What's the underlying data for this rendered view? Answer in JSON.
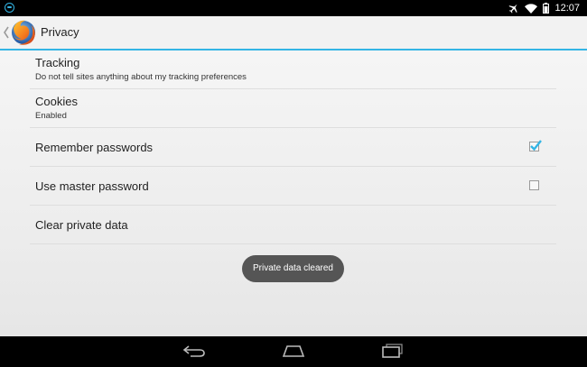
{
  "status_bar": {
    "time": "12:07",
    "icons": [
      "notification-icon",
      "airplane-icon",
      "wifi-icon",
      "battery-icon"
    ]
  },
  "action_bar": {
    "title": "Privacy",
    "logo": "firefox-logo",
    "accent_color": "#33b5e5"
  },
  "settings": [
    {
      "title": "Tracking",
      "summary": "Do not tell sites anything about my tracking preferences"
    },
    {
      "title": "Cookies",
      "summary": "Enabled"
    },
    {
      "title": "Remember passwords",
      "checked": true
    },
    {
      "title": "Use master password",
      "checked": false
    },
    {
      "title": "Clear private data"
    }
  ],
  "toast": {
    "message": "Private data cleared"
  },
  "nav_bar": {
    "buttons": [
      "back-icon",
      "home-icon",
      "recent-apps-icon"
    ]
  }
}
